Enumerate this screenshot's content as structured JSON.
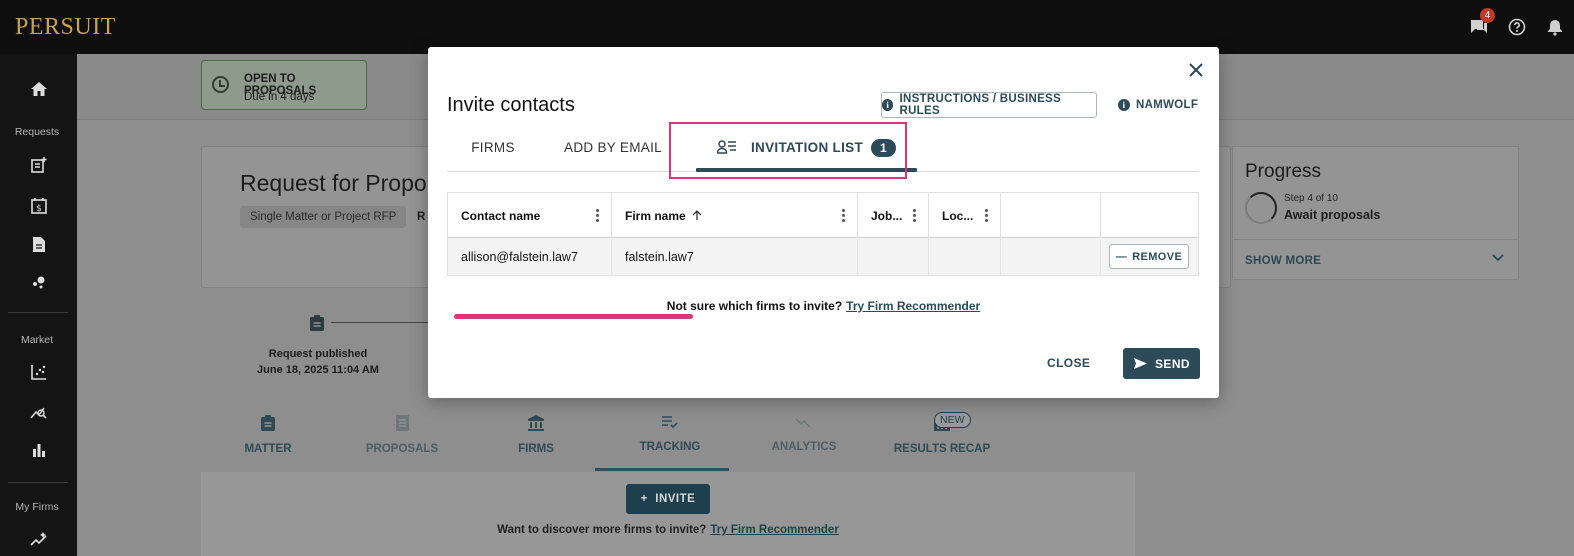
{
  "app": {
    "logo": "PERSUIT",
    "notification_count": "4"
  },
  "sidebar": {
    "requests_label": "Requests",
    "market_label": "Market",
    "my_firms_label": "My Firms"
  },
  "status": {
    "title": "OPEN TO PROPOSALS",
    "subtitle": "Due in 4 days"
  },
  "rfp": {
    "title": "Request for Propo",
    "type_chip": "Single Matter or Project RFP",
    "chip_cut": "R"
  },
  "timeline": {
    "event": "Request published",
    "date": "June 18, 2025 11:04 AM"
  },
  "page_tabs": [
    {
      "label": "MATTER"
    },
    {
      "label": "PROPOSALS"
    },
    {
      "label": "FIRMS"
    },
    {
      "label": "TRACKING"
    },
    {
      "label": "ANALYTICS"
    },
    {
      "label": "RESULTS RECAP",
      "badge": "NEW"
    }
  ],
  "invite_button": "INVITE",
  "discover": {
    "text": "Want to discover more firms to invite?",
    "link": "Try Firm Recommender"
  },
  "progress": {
    "title": "Progress",
    "step": "Step 4 of 10",
    "state": "Await proposals",
    "show_more": "SHOW MORE"
  },
  "modal": {
    "title": "Invite contacts",
    "instructions_button": "INSTRUCTIONS / BUSINESS RULES",
    "namwolf": "NAMWOLF",
    "tabs": [
      {
        "label": "FIRMS"
      },
      {
        "label": "ADD BY EMAIL"
      },
      {
        "label": "INVITATION LIST",
        "count": "1",
        "active": true
      }
    ],
    "table": {
      "headers": [
        "Contact name",
        "Firm name",
        "Job...",
        "Loc..."
      ],
      "rows": [
        {
          "contact": "allison@falstein.law7",
          "firm": "falstein.law7",
          "job": "",
          "location": "",
          "action": "REMOVE"
        }
      ]
    },
    "hint": {
      "text": "Not sure which firms to invite?",
      "link": "Try Firm Recommender"
    },
    "close_label": "CLOSE",
    "send_label": "SEND"
  },
  "colors": {
    "brand_gold": "#c9a24d",
    "primary": "#2c4a57",
    "annotation_pink": "#d6397a",
    "topbar": "#0f0f0f"
  }
}
